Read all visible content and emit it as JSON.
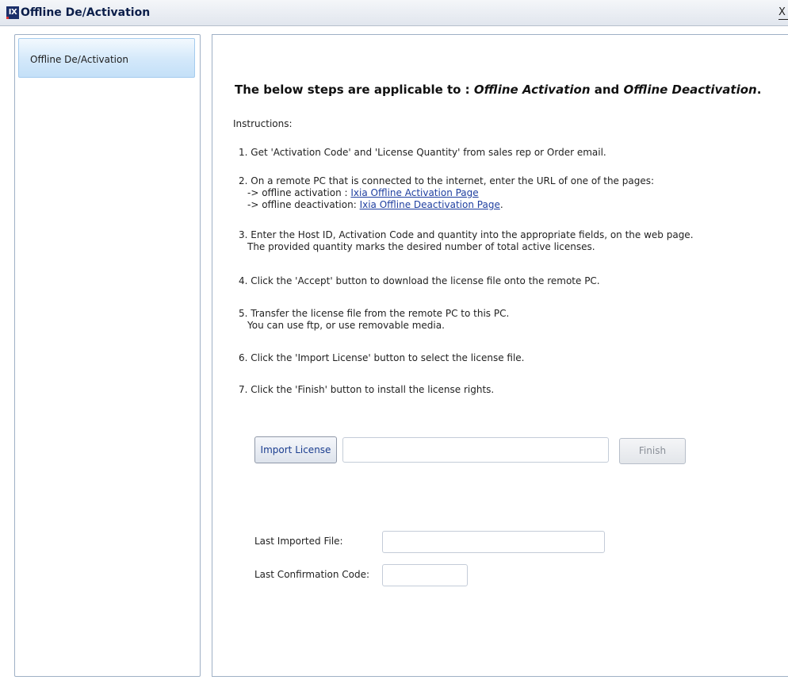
{
  "window": {
    "title": "Offline De/Activation",
    "app_icon": "IX",
    "close_glyph": "X"
  },
  "sidebar": {
    "items": [
      {
        "label": "Offline De/Activation",
        "selected": true
      }
    ]
  },
  "main": {
    "heading_prefix": "The below steps are applicable to : ",
    "heading_em1": "Offline Activation",
    "heading_mid": " and ",
    "heading_em2": "Offline Deactivation",
    "heading_suffix": ".",
    "instructions_label": "Instructions:",
    "steps": {
      "s1": "1. Get 'Activation Code' and 'License Quantity' from sales rep or Order email.",
      "s2_line1": "2. On a remote PC that is connected to the internet, enter the URL of one of the pages:",
      "s2_line2_prefix": "-> offline activation : ",
      "s2_line2_link": "Ixia Offline Activation Page",
      "s2_line3_prefix": "-> offline deactivation: ",
      "s2_line3_link": "Ixia Offline Deactivation Page",
      "s2_line3_suffix": ".",
      "s3_line1": "3. Enter the Host ID, Activation Code and quantity into the appropriate fields, on the web page.",
      "s3_line2": "The provided quantity marks the desired number of total active licenses.",
      "s4": "4. Click the 'Accept' button to download the license file onto the remote PC.",
      "s5_line1": "5. Transfer the license file from the remote PC to this PC.",
      "s5_line2": "You can use ftp, or use removable media.",
      "s6": "6. Click the 'Import License' button to select the license file.",
      "s7": "7. Click the 'Finish' button to install the license rights."
    },
    "import_button": "Import License",
    "file_path_value": "",
    "finish_button": "Finish",
    "finish_enabled": false,
    "last_imported_label": "Last Imported File:",
    "last_imported_value": "",
    "last_confirmation_label": "Last Confirmation Code:",
    "last_confirmation_value": ""
  },
  "colors": {
    "title_text": "#0b1e4a",
    "link": "#1f3fa0",
    "sidebar_selected": "#c4e0f8",
    "border": "#9fb0c5"
  }
}
